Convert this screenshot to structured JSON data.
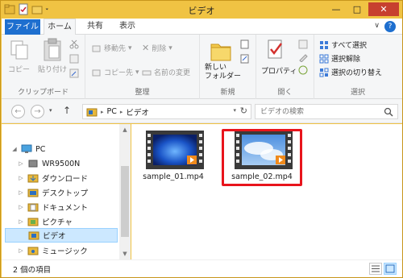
{
  "window": {
    "title": "ビデオ"
  },
  "ribbon_tabs": {
    "file": "ファイル",
    "home": "ホーム",
    "share": "共有",
    "view": "表示"
  },
  "ribbon": {
    "clipboard": {
      "copy": "コピー",
      "paste": "貼り付け",
      "label": "クリップボード"
    },
    "organize": {
      "move_to": "移動先",
      "delete": "削除",
      "copy_to": "コピー先",
      "rename": "名前の変更",
      "label": "整理"
    },
    "new": {
      "new_folder": "新しい\nフォルダー",
      "new_folder_l1": "新しい",
      "new_folder_l2": "フォルダー",
      "label": "新規"
    },
    "open": {
      "properties": "プロパティ",
      "label": "開く"
    },
    "select": {
      "select_all": "すべて選択",
      "select_none": "選択解除",
      "invert": "選択の切り替え",
      "label": "選択"
    }
  },
  "address": {
    "crumbs": [
      "PC",
      "ビデオ"
    ],
    "search_placeholder": "ビデオの検索"
  },
  "nav_tree": [
    {
      "label": "PC",
      "expanded": true
    },
    {
      "label": "WR9500N"
    },
    {
      "label": "ダウンロード"
    },
    {
      "label": "デスクトップ"
    },
    {
      "label": "ドキュメント"
    },
    {
      "label": "ピクチャ"
    },
    {
      "label": "ビデオ",
      "selected": true
    },
    {
      "label": "ミュージック"
    }
  ],
  "files": [
    {
      "name": "sample_01.mp4"
    },
    {
      "name": "sample_02.mp4",
      "highlighted": true
    }
  ],
  "status": {
    "item_count": "2 個の項目"
  },
  "colors": {
    "titlebar": "#f0c343",
    "file_tab": "#1e6fcf",
    "highlight": "#e8141c",
    "selected": "#cce8ff"
  }
}
